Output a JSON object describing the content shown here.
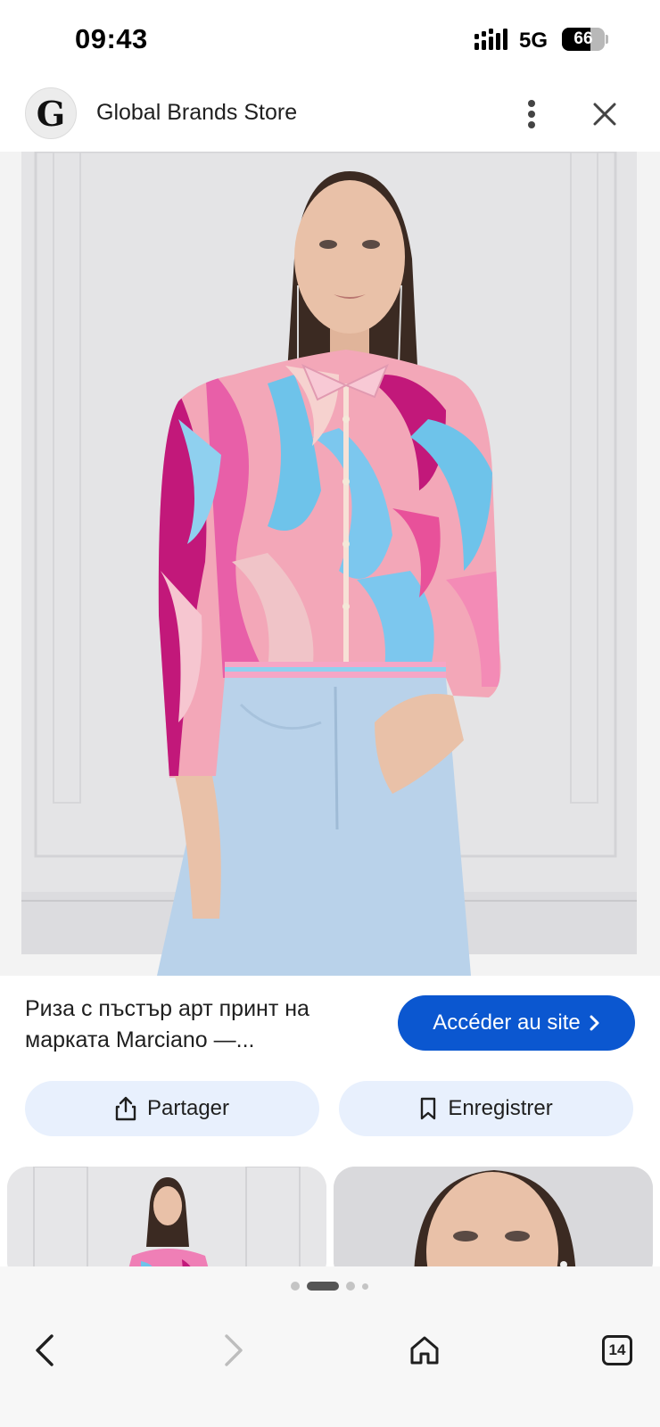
{
  "status_bar": {
    "time": "09:43",
    "network": "5G",
    "battery_percent": 66,
    "battery_label": "66"
  },
  "header": {
    "logo_letter": "G",
    "store_name": "Global Brands Store",
    "icons": {
      "menu": "more-vertical-icon",
      "close": "close-icon"
    }
  },
  "product": {
    "title": "Риза с пъстър арт принт на марката Marciano —...",
    "visit_button": "Accéder au site"
  },
  "actions": {
    "share_label": "Partager",
    "save_label": "Enregistrer"
  },
  "pager": {
    "page_count": 4,
    "active_index": 1
  },
  "nav": {
    "tabs_count": "14"
  },
  "colors": {
    "primary": "#0b57d0",
    "action_bg": "#e8f0fd",
    "shirt_pink": "#e8519a",
    "shirt_blue": "#6ec3ea",
    "jeans": "#b9d2ea"
  }
}
